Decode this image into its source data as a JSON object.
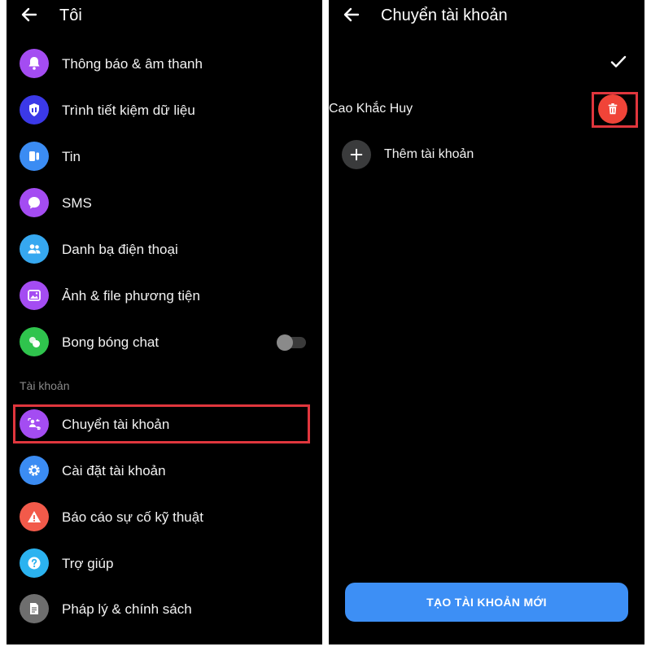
{
  "left_panel": {
    "title": "Tôi",
    "items": [
      {
        "label": "Thông báo & âm thanh",
        "icon": "bell-icon",
        "color": "#a44cf2"
      },
      {
        "label": "Trình tiết kiệm dữ liệu",
        "icon": "data-saver-shield-icon",
        "color": "#3b39e8"
      },
      {
        "label": "Tin",
        "icon": "stories-icon",
        "color": "#3b8cf3"
      },
      {
        "label": "SMS",
        "icon": "sms-bubble-icon",
        "color": "#a44cf2"
      },
      {
        "label": "Danh bạ điện thoại",
        "icon": "contacts-icon",
        "color": "#36a8f0"
      },
      {
        "label": "Ảnh & file phương tiện",
        "icon": "photo-icon",
        "color": "#a44cf2"
      },
      {
        "label": "Bong bóng chat",
        "icon": "chat-heads-icon",
        "color": "#2fc44d",
        "toggle": false
      }
    ],
    "section_label": "Tài khoản",
    "account_items": [
      {
        "label": "Chuyển tài khoản",
        "icon": "switch-account-icon",
        "color": "#a44cf2"
      },
      {
        "label": "Cài đặt tài khoản",
        "icon": "gear-icon",
        "color": "#3b8cf3"
      },
      {
        "label": "Báo cáo sự cố kỹ thuật",
        "icon": "warning-icon",
        "color": "#f25a4a"
      },
      {
        "label": "Trợ giúp",
        "icon": "help-icon",
        "color": "#2bb3f0"
      },
      {
        "label": "Pháp lý & chính sách",
        "icon": "document-icon",
        "color": "#6e6e6e"
      }
    ]
  },
  "right_panel": {
    "title": "Chuyển tài khoản",
    "account_name": "Cao Khắc Huy",
    "add_account_label": "Thêm tài khoản",
    "create_button_label": "TẠO TÀI KHOẢN MỚI"
  },
  "colors": {
    "background": "#000000",
    "highlight": "#e0363d",
    "primary_button": "#3d8ff5",
    "delete": "#f04438"
  }
}
